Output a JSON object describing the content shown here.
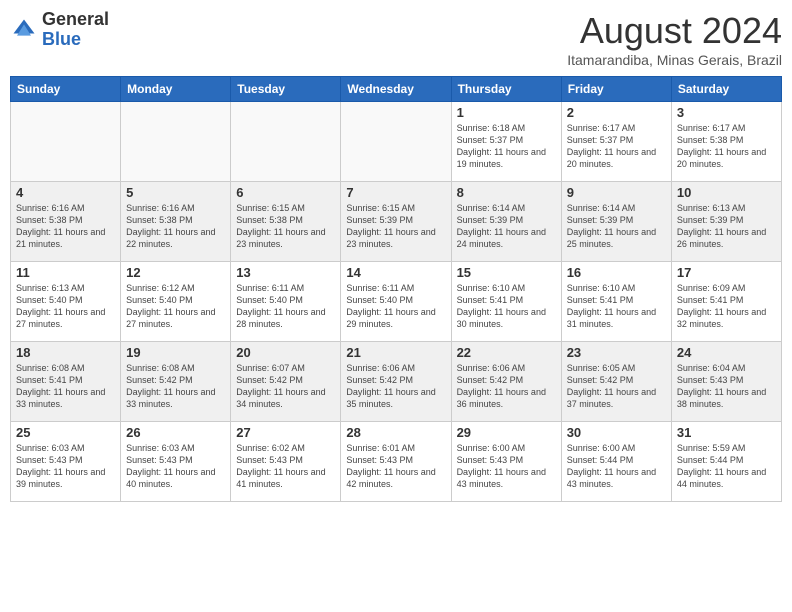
{
  "logo": {
    "general": "General",
    "blue": "Blue"
  },
  "title": {
    "month_year": "August 2024",
    "location": "Itamarandiba, Minas Gerais, Brazil"
  },
  "headers": [
    "Sunday",
    "Monday",
    "Tuesday",
    "Wednesday",
    "Thursday",
    "Friday",
    "Saturday"
  ],
  "weeks": [
    [
      {
        "day": "",
        "info": ""
      },
      {
        "day": "",
        "info": ""
      },
      {
        "day": "",
        "info": ""
      },
      {
        "day": "",
        "info": ""
      },
      {
        "day": "1",
        "info": "Sunrise: 6:18 AM\nSunset: 5:37 PM\nDaylight: 11 hours\nand 19 minutes."
      },
      {
        "day": "2",
        "info": "Sunrise: 6:17 AM\nSunset: 5:37 PM\nDaylight: 11 hours\nand 20 minutes."
      },
      {
        "day": "3",
        "info": "Sunrise: 6:17 AM\nSunset: 5:38 PM\nDaylight: 11 hours\nand 20 minutes."
      }
    ],
    [
      {
        "day": "4",
        "info": "Sunrise: 6:16 AM\nSunset: 5:38 PM\nDaylight: 11 hours\nand 21 minutes."
      },
      {
        "day": "5",
        "info": "Sunrise: 6:16 AM\nSunset: 5:38 PM\nDaylight: 11 hours\nand 22 minutes."
      },
      {
        "day": "6",
        "info": "Sunrise: 6:15 AM\nSunset: 5:38 PM\nDaylight: 11 hours\nand 23 minutes."
      },
      {
        "day": "7",
        "info": "Sunrise: 6:15 AM\nSunset: 5:39 PM\nDaylight: 11 hours\nand 23 minutes."
      },
      {
        "day": "8",
        "info": "Sunrise: 6:14 AM\nSunset: 5:39 PM\nDaylight: 11 hours\nand 24 minutes."
      },
      {
        "day": "9",
        "info": "Sunrise: 6:14 AM\nSunset: 5:39 PM\nDaylight: 11 hours\nand 25 minutes."
      },
      {
        "day": "10",
        "info": "Sunrise: 6:13 AM\nSunset: 5:39 PM\nDaylight: 11 hours\nand 26 minutes."
      }
    ],
    [
      {
        "day": "11",
        "info": "Sunrise: 6:13 AM\nSunset: 5:40 PM\nDaylight: 11 hours\nand 27 minutes."
      },
      {
        "day": "12",
        "info": "Sunrise: 6:12 AM\nSunset: 5:40 PM\nDaylight: 11 hours\nand 27 minutes."
      },
      {
        "day": "13",
        "info": "Sunrise: 6:11 AM\nSunset: 5:40 PM\nDaylight: 11 hours\nand 28 minutes."
      },
      {
        "day": "14",
        "info": "Sunrise: 6:11 AM\nSunset: 5:40 PM\nDaylight: 11 hours\nand 29 minutes."
      },
      {
        "day": "15",
        "info": "Sunrise: 6:10 AM\nSunset: 5:41 PM\nDaylight: 11 hours\nand 30 minutes."
      },
      {
        "day": "16",
        "info": "Sunrise: 6:10 AM\nSunset: 5:41 PM\nDaylight: 11 hours\nand 31 minutes."
      },
      {
        "day": "17",
        "info": "Sunrise: 6:09 AM\nSunset: 5:41 PM\nDaylight: 11 hours\nand 32 minutes."
      }
    ],
    [
      {
        "day": "18",
        "info": "Sunrise: 6:08 AM\nSunset: 5:41 PM\nDaylight: 11 hours\nand 33 minutes."
      },
      {
        "day": "19",
        "info": "Sunrise: 6:08 AM\nSunset: 5:42 PM\nDaylight: 11 hours\nand 33 minutes."
      },
      {
        "day": "20",
        "info": "Sunrise: 6:07 AM\nSunset: 5:42 PM\nDaylight: 11 hours\nand 34 minutes."
      },
      {
        "day": "21",
        "info": "Sunrise: 6:06 AM\nSunset: 5:42 PM\nDaylight: 11 hours\nand 35 minutes."
      },
      {
        "day": "22",
        "info": "Sunrise: 6:06 AM\nSunset: 5:42 PM\nDaylight: 11 hours\nand 36 minutes."
      },
      {
        "day": "23",
        "info": "Sunrise: 6:05 AM\nSunset: 5:42 PM\nDaylight: 11 hours\nand 37 minutes."
      },
      {
        "day": "24",
        "info": "Sunrise: 6:04 AM\nSunset: 5:43 PM\nDaylight: 11 hours\nand 38 minutes."
      }
    ],
    [
      {
        "day": "25",
        "info": "Sunrise: 6:03 AM\nSunset: 5:43 PM\nDaylight: 11 hours\nand 39 minutes."
      },
      {
        "day": "26",
        "info": "Sunrise: 6:03 AM\nSunset: 5:43 PM\nDaylight: 11 hours\nand 40 minutes."
      },
      {
        "day": "27",
        "info": "Sunrise: 6:02 AM\nSunset: 5:43 PM\nDaylight: 11 hours\nand 41 minutes."
      },
      {
        "day": "28",
        "info": "Sunrise: 6:01 AM\nSunset: 5:43 PM\nDaylight: 11 hours\nand 42 minutes."
      },
      {
        "day": "29",
        "info": "Sunrise: 6:00 AM\nSunset: 5:43 PM\nDaylight: 11 hours\nand 43 minutes."
      },
      {
        "day": "30",
        "info": "Sunrise: 6:00 AM\nSunset: 5:44 PM\nDaylight: 11 hours\nand 43 minutes."
      },
      {
        "day": "31",
        "info": "Sunrise: 5:59 AM\nSunset: 5:44 PM\nDaylight: 11 hours\nand 44 minutes."
      }
    ]
  ]
}
